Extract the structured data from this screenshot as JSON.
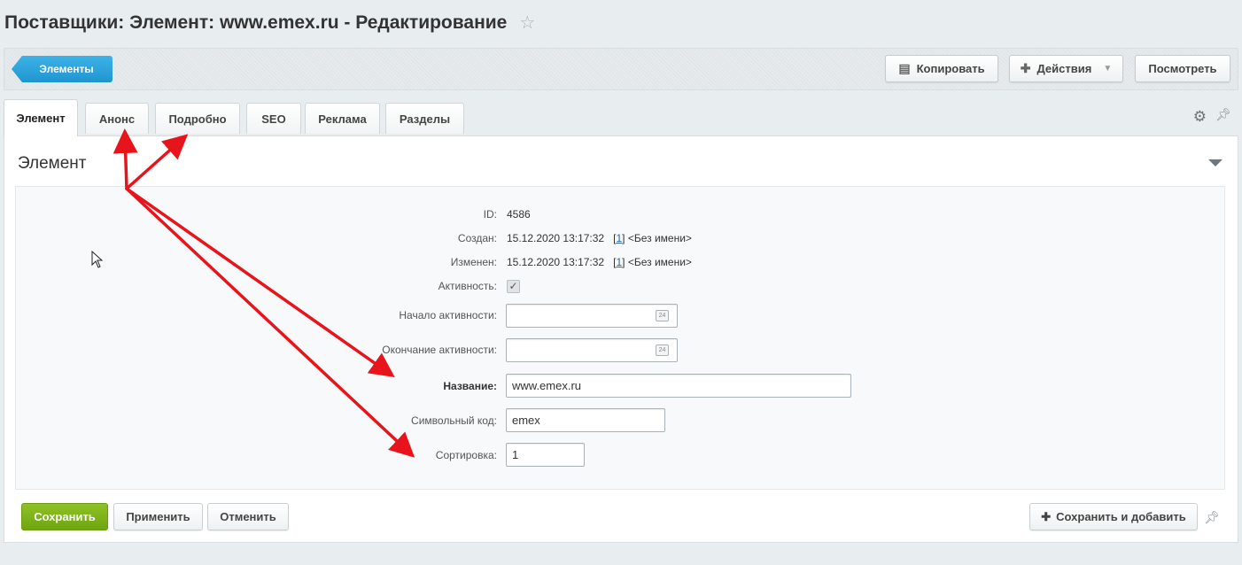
{
  "header": {
    "title": "Поставщики: Элемент: www.emex.ru - Редактирование",
    "star_icon": "star-icon"
  },
  "toolbar": {
    "back_label": "Элементы",
    "copy_label": "Копировать",
    "actions_label": "Действия",
    "view_label": "Посмотреть"
  },
  "tabs": [
    {
      "label": "Элемент",
      "active": true
    },
    {
      "label": "Анонс"
    },
    {
      "label": "Подробно"
    },
    {
      "label": "SEO"
    },
    {
      "label": "Реклама"
    },
    {
      "label": "Разделы"
    }
  ],
  "section": {
    "title": "Элемент"
  },
  "fields": {
    "id": {
      "label": "ID:",
      "value": "4586"
    },
    "created": {
      "label": "Создан:",
      "date": "15.12.2020 13:17:32",
      "user_id": "1",
      "user_name": "<Без имени>"
    },
    "modified": {
      "label": "Изменен:",
      "date": "15.12.2020 13:17:32",
      "user_id": "1",
      "user_name": "<Без имени>"
    },
    "active": {
      "label": "Активность:",
      "checked": true,
      "check_mark": "✓"
    },
    "active_from": {
      "label": "Начало активности:",
      "value": "",
      "calendar_icon": "24"
    },
    "active_to": {
      "label": "Окончание активности:",
      "value": "",
      "calendar_icon": "24"
    },
    "name": {
      "label": "Название:",
      "value": "www.emex.ru"
    },
    "code": {
      "label": "Символьный код:",
      "value": "emex"
    },
    "sort": {
      "label": "Сортировка:",
      "value": "1"
    }
  },
  "footer": {
    "save_label": "Сохранить",
    "apply_label": "Применить",
    "cancel_label": "Отменить",
    "save_add_label": "Сохранить и добавить"
  },
  "annotation": {
    "arrow_color": "#e8141c"
  },
  "colors": {
    "save_green": "#7cb518",
    "back_blue": "#2aa3dc",
    "link_blue": "#2067b0"
  }
}
